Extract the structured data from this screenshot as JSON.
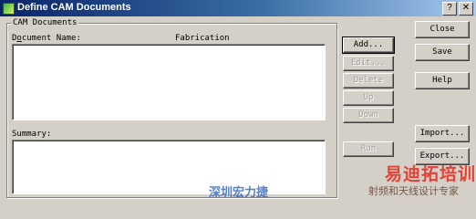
{
  "window": {
    "title": "Define CAM Documents",
    "close_glyph": "✕",
    "help_glyph": "?"
  },
  "group": {
    "legend": "CAM Documents"
  },
  "columns": {
    "doc_name": "Document Name:",
    "doc_name_access": "o",
    "fabrication": "Fabrication"
  },
  "summary": {
    "label": "Summary:"
  },
  "list_buttons": {
    "add": "Add...",
    "edit": "Edit...",
    "delete": "Delete",
    "up": "Up",
    "down": "Down",
    "run": "Run"
  },
  "right_buttons": {
    "close": "Close",
    "save": "Save",
    "help": "Help",
    "import": "Import...",
    "export": "Export..."
  },
  "watermarks": {
    "brand_cn": "易迪拓培训",
    "slogan_cn": "射频和天线设计专家",
    "shop_cn": "深圳宏力捷"
  }
}
